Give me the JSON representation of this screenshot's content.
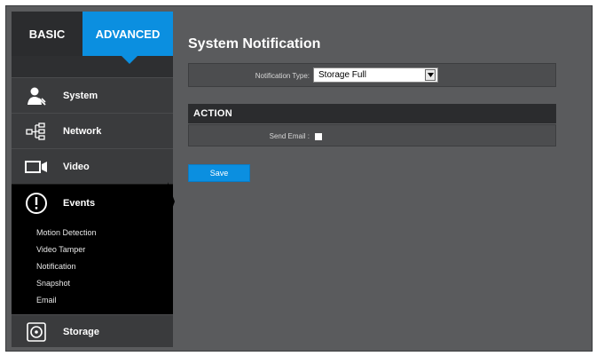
{
  "tabs": {
    "basic": "BASIC",
    "advanced": "ADVANCED"
  },
  "sidebar": {
    "items": [
      {
        "label": "System",
        "icon": "system-admin-icon"
      },
      {
        "label": "Network",
        "icon": "network-icon"
      },
      {
        "label": "Video",
        "icon": "video-camera-icon"
      },
      {
        "label": "Events",
        "icon": "events-alert-icon"
      },
      {
        "label": "Storage",
        "icon": "storage-disk-icon"
      }
    ],
    "events_submenu": [
      "Motion Detection",
      "Video Tamper",
      "Notification",
      "Snapshot",
      "Email"
    ]
  },
  "main": {
    "title": "System Notification",
    "notification_type_label": "Notification Type:",
    "notification_type_value": "Storage Full",
    "action_header": "ACTION",
    "send_email_label": "Send Email :",
    "send_email_checked": false,
    "save_label": "Save"
  },
  "colors": {
    "accent": "#0b8fe0",
    "sidebar_bg": "#3a3b3d",
    "active_bg": "#000000",
    "panel_bg": "#5a5b5d"
  }
}
